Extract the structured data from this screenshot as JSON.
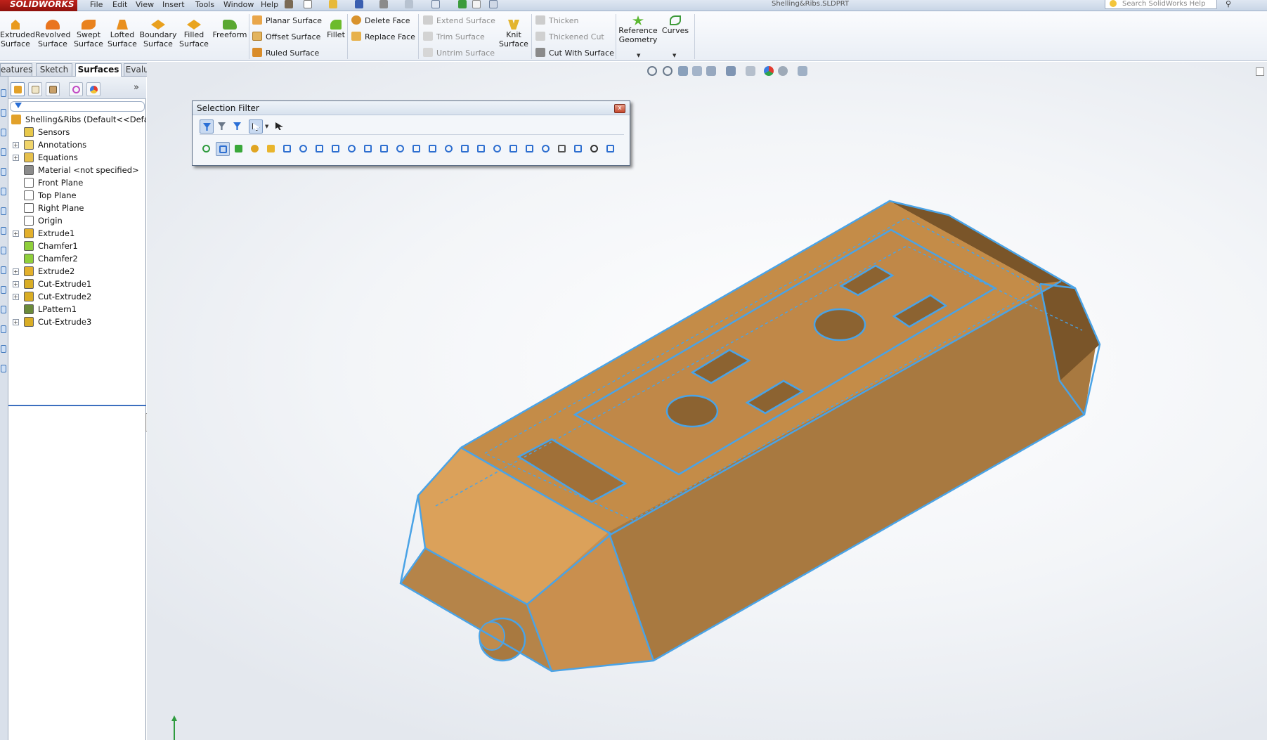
{
  "app": {
    "logo": "SOLIDWORKS",
    "file_title": "Shelling&Ribs.SLDPRT",
    "menu": [
      "File",
      "Edit",
      "View",
      "Insert",
      "Tools",
      "Window",
      "Help"
    ],
    "search_placeholder": "Search SolidWorks Help"
  },
  "command_manager": {
    "big_buttons": [
      {
        "line1": "Extruded",
        "line2": "Surface",
        "icon": "extruded-surface-icon",
        "color": "#e99a1e"
      },
      {
        "line1": "Revolved",
        "line2": "Surface",
        "icon": "revolved-surface-icon",
        "color": "#e9741e"
      },
      {
        "line1": "Swept",
        "line2": "Surface",
        "icon": "swept-surface-icon",
        "color": "#e9821e"
      },
      {
        "line1": "Lofted",
        "line2": "Surface",
        "icon": "lofted-surface-icon",
        "color": "#e98f1e"
      },
      {
        "line1": "Boundary",
        "line2": "Surface",
        "icon": "boundary-surface-icon",
        "color": "#e9a01e"
      },
      {
        "line1": "Filled",
        "line2": "Surface",
        "icon": "filled-surface-icon",
        "color": "#e9a41e"
      },
      {
        "line1": "Freeform",
        "line2": "",
        "icon": "freeform-icon",
        "color": "#5aa832"
      }
    ],
    "group1": [
      {
        "label": "Planar Surface",
        "icon": "planar-surface-icon",
        "enabled": true
      },
      {
        "label": "Offset Surface",
        "icon": "offset-surface-icon",
        "enabled": true
      },
      {
        "label": "Ruled Surface",
        "icon": "ruled-surface-icon",
        "enabled": true
      }
    ],
    "fillet": {
      "label": "Fillet",
      "icon": "fillet-icon"
    },
    "group2": [
      {
        "label": "Delete Face",
        "icon": "delete-face-icon",
        "enabled": true
      },
      {
        "label": "Replace Face",
        "icon": "replace-face-icon",
        "enabled": true
      }
    ],
    "group3": [
      {
        "label": "Extend Surface",
        "icon": "extend-surface-icon",
        "enabled": false
      },
      {
        "label": "Trim Surface",
        "icon": "trim-surface-icon",
        "enabled": false
      },
      {
        "label": "Untrim Surface",
        "icon": "untrim-surface-icon",
        "enabled": false
      }
    ],
    "knit": {
      "line1": "Knit",
      "line2": "Surface",
      "icon": "knit-surface-icon"
    },
    "group4": [
      {
        "label": "Thicken",
        "icon": "thicken-icon",
        "enabled": false
      },
      {
        "label": "Thickened Cut",
        "icon": "thickened-cut-icon",
        "enabled": false
      },
      {
        "label": "Cut With Surface",
        "icon": "cut-with-surface-icon",
        "enabled": true
      }
    ],
    "reference_geometry": {
      "line1": "Reference",
      "line2": "Geometry",
      "icon": "reference-geometry-icon"
    },
    "curves": {
      "label": "Curves",
      "icon": "curves-icon"
    }
  },
  "tabs": [
    {
      "label": "eatures",
      "active": false
    },
    {
      "label": "Sketch",
      "active": false
    },
    {
      "label": "Surfaces",
      "active": true
    },
    {
      "label": "Evaluate",
      "active": false
    }
  ],
  "feature_tree": {
    "root": "Shelling&Ribs  (Default<<Defau",
    "items": [
      {
        "label": "Sensors",
        "icon": "sensors-icon",
        "expandable": false
      },
      {
        "label": "Annotations",
        "icon": "annotations-icon",
        "expandable": true
      },
      {
        "label": "Equations",
        "icon": "equations-icon",
        "expandable": true
      },
      {
        "label": "Material <not specified>",
        "icon": "material-icon",
        "expandable": false
      },
      {
        "label": "Front Plane",
        "icon": "plane-icon",
        "expandable": false
      },
      {
        "label": "Top Plane",
        "icon": "plane-icon",
        "expandable": false
      },
      {
        "label": "Right Plane",
        "icon": "plane-icon",
        "expandable": false
      },
      {
        "label": "Origin",
        "icon": "origin-icon",
        "expandable": false
      },
      {
        "label": "Extrude1",
        "icon": "extrude-icon",
        "expandable": true
      },
      {
        "label": "Chamfer1",
        "icon": "chamfer-icon",
        "expandable": false
      },
      {
        "label": "Chamfer2",
        "icon": "chamfer-icon",
        "expandable": false
      },
      {
        "label": "Extrude2",
        "icon": "extrude-icon",
        "expandable": true
      },
      {
        "label": "Cut-Extrude1",
        "icon": "cut-extrude-icon",
        "expandable": true
      },
      {
        "label": "Cut-Extrude2",
        "icon": "cut-extrude-icon",
        "expandable": true
      },
      {
        "label": "LPattern1",
        "icon": "linear-pattern-icon",
        "expandable": false
      },
      {
        "label": "Cut-Extrude3",
        "icon": "cut-extrude-icon",
        "expandable": true
      }
    ]
  },
  "selection_filter": {
    "title": "Selection Filter",
    "close_label": "x"
  },
  "colors": {
    "model_top": "#d9a05a",
    "model_side": "#a87940",
    "model_dark": "#7a5529",
    "edge_highlight": "#4aa3e6",
    "accent": "#3c6fbf"
  }
}
